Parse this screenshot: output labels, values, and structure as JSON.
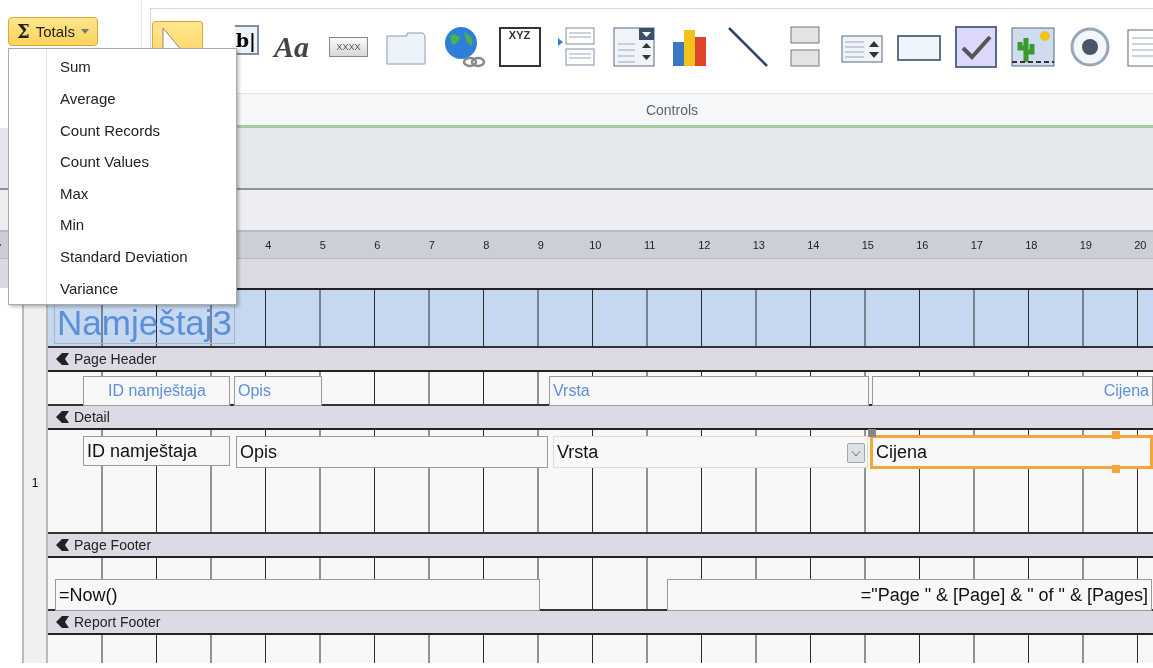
{
  "totals_button": {
    "glyph": "Σ",
    "label": "Totals",
    "expanded": true
  },
  "totals_menu": {
    "items": [
      {
        "label": "Sum"
      },
      {
        "label": "Average"
      },
      {
        "label": "Count Records"
      },
      {
        "label": "Count Values"
      },
      {
        "label": "Max"
      },
      {
        "label": "Min"
      },
      {
        "label": "Standard Deviation"
      },
      {
        "label": "Variance"
      }
    ]
  },
  "ribbon": {
    "group_label": "Controls",
    "tools": [
      {
        "kind": "pointer",
        "selected": true
      },
      {
        "kind": "textbox",
        "selected": false,
        "glyph": "b|"
      },
      {
        "kind": "label",
        "selected": false,
        "glyph": "Aa"
      },
      {
        "kind": "button",
        "selected": false,
        "glyph": "XXXX"
      },
      {
        "kind": "tab",
        "selected": false
      },
      {
        "kind": "hyperlink",
        "selected": false
      },
      {
        "kind": "frame",
        "selected": false,
        "glyph": "XYZ"
      },
      {
        "kind": "navigation",
        "selected": false
      },
      {
        "kind": "combo",
        "selected": false
      },
      {
        "kind": "chart",
        "selected": false
      },
      {
        "kind": "line",
        "selected": false
      },
      {
        "kind": "pagebreak",
        "selected": false
      },
      {
        "kind": "listbox",
        "selected": false
      },
      {
        "kind": "rectangle",
        "selected": false
      },
      {
        "kind": "checkbox",
        "selected": false
      },
      {
        "kind": "image",
        "selected": false
      },
      {
        "kind": "radio",
        "selected": false
      },
      {
        "kind": "list",
        "selected": false
      }
    ]
  },
  "ruler": {
    "marks": [
      "4",
      "5",
      "6",
      "7",
      "8",
      "9",
      "10",
      "11",
      "12",
      "13",
      "14",
      "15",
      "16",
      "17",
      "18",
      "19",
      "20"
    ]
  },
  "report": {
    "header_title": "Namještaj3",
    "sections": [
      {
        "title": "Page Header",
        "controls": [
          {
            "kind": "label",
            "text": "ID namještaja"
          },
          {
            "kind": "label",
            "text": "Opis"
          },
          {
            "kind": "label",
            "text": "Vrsta"
          },
          {
            "kind": "label",
            "text": "Cijena",
            "right_aligned": true
          }
        ]
      },
      {
        "title": "Detail",
        "side_mark": "1",
        "controls": [
          {
            "kind": "textbox",
            "text": "ID namještaja",
            "selected": false
          },
          {
            "kind": "textbox",
            "text": "Opis",
            "selected": false
          },
          {
            "kind": "combo",
            "text": "Vrsta",
            "selected": false
          },
          {
            "kind": "textbox",
            "text": "Cijena",
            "selected": true
          }
        ]
      },
      {
        "title": "Page Footer",
        "controls": [
          {
            "kind": "textbox",
            "text": "=Now()",
            "selected": false
          },
          {
            "kind": "textbox",
            "text": "=\"Page \" & [Page] & \" of \" & [Pages]",
            "right_aligned": true,
            "selected": false
          }
        ]
      },
      {
        "title": "Report Footer"
      }
    ]
  }
}
